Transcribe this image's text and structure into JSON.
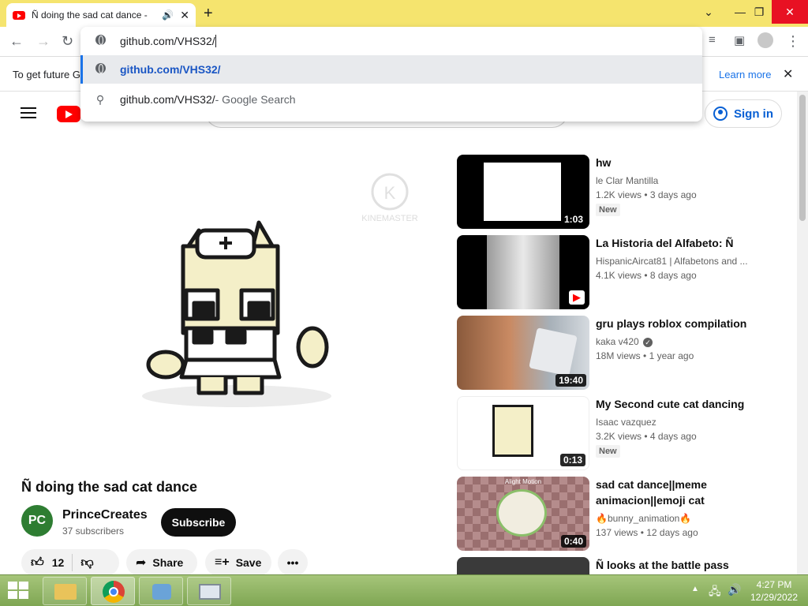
{
  "browser": {
    "tab_title": "Ñ doing the sad cat dance -",
    "url_value": "github.com/VHS32/",
    "omni_suggestion_url": "github.com/VHS32/",
    "omni_search_query": "github.com/VHS32/",
    "omni_search_suffix": " - Google Search",
    "info_text": "To get future G",
    "learn_more": "Learn more"
  },
  "youtube": {
    "sign_in": "Sign in",
    "video": {
      "title": "Ñ doing the sad cat dance",
      "watermark": "KINEMASTER",
      "channel_avatar": "PC",
      "channel_name": "PrinceCreates",
      "subscribers": "37 subscribers",
      "subscribe_label": "Subscribe",
      "likes": "12",
      "share_label": "Share",
      "save_label": "Save"
    },
    "sidebar": [
      {
        "title": "hw",
        "channel": "le Clar Mantilla",
        "views": "1.2K views",
        "age": "3 days ago",
        "badge": "New",
        "duration": "1:03"
      },
      {
        "title": "La Historia del Alfabeto: Ñ",
        "channel": "HispanicAircat81 | Alfabetons and ...",
        "views": "4.1K views",
        "age": "8 days ago",
        "badge": "",
        "duration": ""
      },
      {
        "title": "gru plays roblox compilation",
        "channel": "kaka v420",
        "views": "18M views",
        "age": "1 year ago",
        "badge": "",
        "duration": "19:40"
      },
      {
        "title": "My Second cute cat dancing",
        "channel": "Isaac vazquez",
        "views": "3.2K views",
        "age": "4 days ago",
        "badge": "New",
        "duration": "0:13"
      },
      {
        "title": "sad cat dance||meme animacion||emoji cat",
        "channel": "🔥bunny_animation🔥",
        "views": "137 views",
        "age": "12 days ago",
        "badge": "",
        "duration": "0:40",
        "thumb_text": "Alight Motion"
      },
      {
        "title": "Ñ looks at the battle pass",
        "channel": "",
        "views": "",
        "age": "",
        "badge": "",
        "duration": ""
      }
    ]
  },
  "taskbar": {
    "time": "4:27 PM",
    "date": "12/29/2022"
  },
  "colors": {
    "titlebar": "#f5e46e",
    "youtube_red": "#ff0000",
    "link_blue": "#065fd4",
    "taskbar_green": "#8db45f"
  }
}
